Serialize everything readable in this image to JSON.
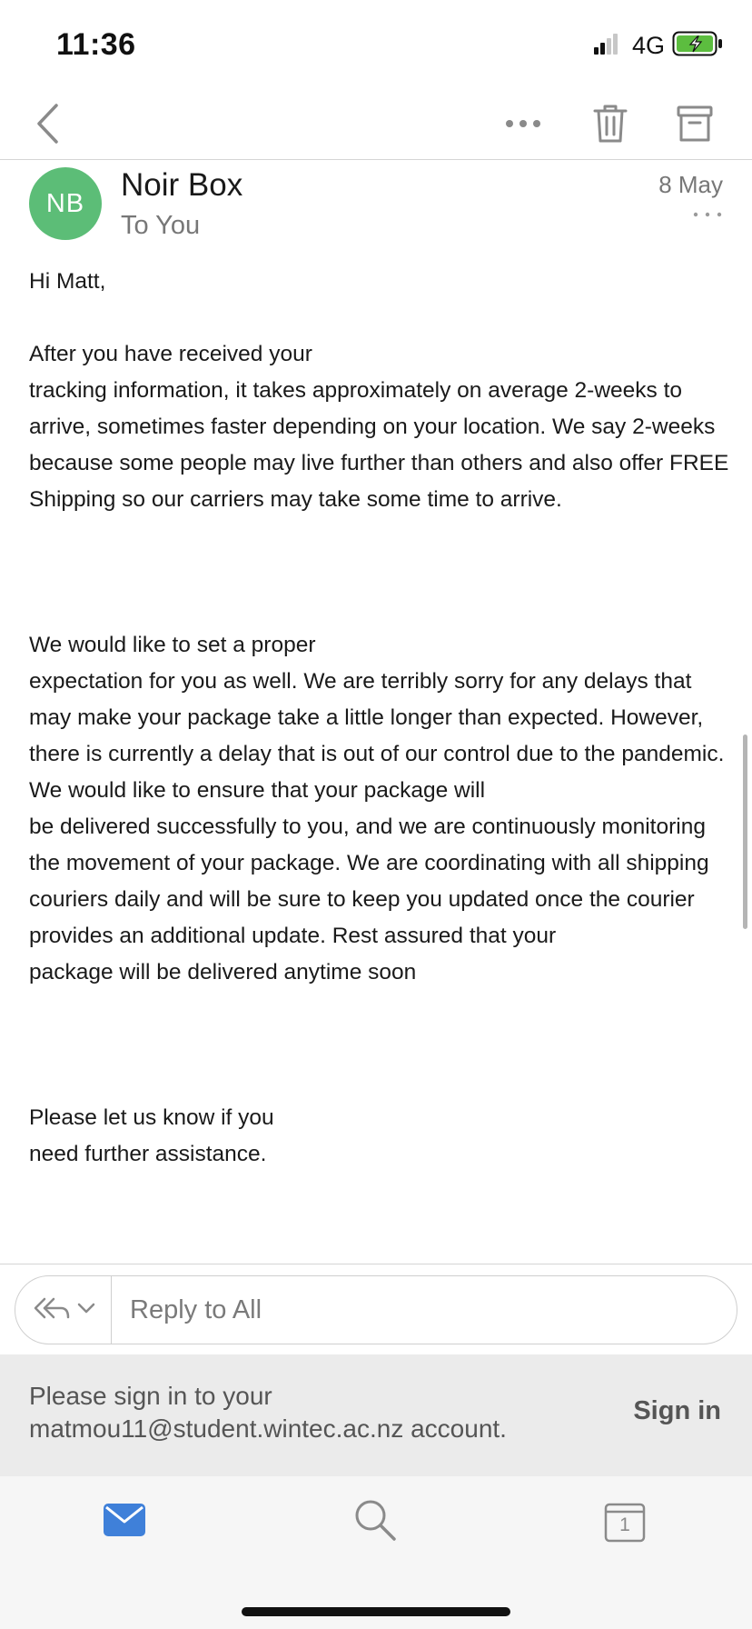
{
  "status_bar": {
    "time": "11:36",
    "network": "4G",
    "signal_icon": "signal-bars-icon",
    "battery_icon": "battery-charging-icon",
    "battery_color": "#5cbd3f"
  },
  "nav": {
    "back_icon": "chevron-left-icon",
    "more_icon": "more-horizontal-icon",
    "delete_icon": "trash-icon",
    "archive_icon": "archive-icon"
  },
  "message": {
    "avatar_initials": "NB",
    "avatar_color": "#5cbd77",
    "sender": "Noir Box",
    "recipient": "To You",
    "date": "8 May",
    "greeting": "Hi Matt,",
    "paragraph_1": "After you have received your\ntracking information, it takes approximately on average 2-weeks to arrive, sometimes faster depending on your location. We say 2-weeks because some people may live further than others and also offer FREE Shipping so our carriers may take some time to arrive.",
    "paragraph_2": "We would like to set a proper\nexpectation for you as well. We are terribly sorry for any delays that may make your package take a little longer than expected. However, there is currently a delay that is out of our control due to the pandemic. We would like to ensure that your package will\nbe delivered successfully to you, and we are continuously monitoring the movement of your package. We are coordinating with all shipping couriers daily and will be sure to keep you updated once the courier provides an additional update.  Rest assured that your\npackage will be delivered anytime soon",
    "paragraph_3": "Please let us know if you\nneed further assistance."
  },
  "reply": {
    "type_icon": "reply-all-icon",
    "dropdown_icon": "chevron-down-icon",
    "placeholder": "Reply to All"
  },
  "signin_banner": {
    "message": "Please sign in to your matmou11@student.wintec.ac.nz account.",
    "button_label": "Sign in"
  },
  "tab_bar": {
    "accent_color": "#3f80d9",
    "mail_icon": "mail-icon",
    "search_icon": "search-icon",
    "calendar_icon": "calendar-icon",
    "calendar_day": "1"
  }
}
